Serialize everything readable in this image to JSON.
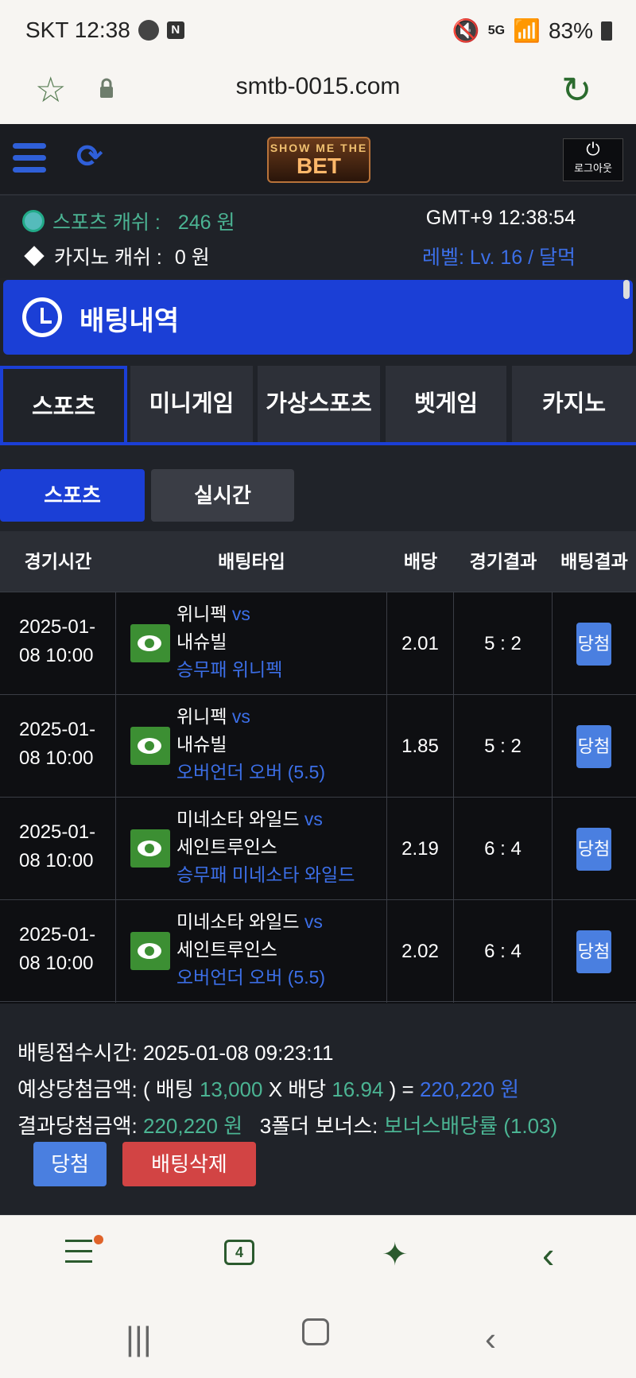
{
  "status_bar": {
    "carrier_time": "SKT 12:38",
    "battery": "83%",
    "network": "5G"
  },
  "browser": {
    "url": "smtb-0015.com"
  },
  "header": {
    "logo_top": "SHOW ME THE",
    "logo_main": "BET",
    "logout_label": "로그아웃"
  },
  "account": {
    "sports_cash_label": "스포츠 캐쉬 :",
    "sports_cash_value": "246 원",
    "casino_cash_label": "카지노 캐쉬 :",
    "casino_cash_value": "0 원",
    "clock": "GMT+9 12:38:54",
    "level": "레벨: Lv. 16 / 달먹"
  },
  "page_title": "배팅내역",
  "tabs": [
    "스포츠",
    "미니게임",
    "가상스포츠",
    "벳게임",
    "카지노"
  ],
  "subtabs": [
    "스포츠",
    "실시간"
  ],
  "table": {
    "headers": [
      "경기시간",
      "배팅타입",
      "배당",
      "경기결과",
      "배팅결과"
    ],
    "rows": [
      {
        "time1": "2025-01-",
        "time2": "08 10:00",
        "team1": "위니펙",
        "vs": "vs",
        "team2": "내슈빌",
        "pick": "승무패 위니펙",
        "odds": "2.01",
        "score": "5 : 2",
        "result": "당첨"
      },
      {
        "time1": "2025-01-",
        "time2": "08 10:00",
        "team1": "위니펙",
        "vs": "vs",
        "team2": "내슈빌",
        "pick": "오버언더 오버 (5.5)",
        "odds": "1.85",
        "score": "5 : 2",
        "result": "당첨"
      },
      {
        "time1": "2025-01-",
        "time2": "08 10:00",
        "team1": "미네소타 와일드",
        "vs": "vs",
        "team2": "세인트루인스",
        "pick": "승무패 미네소타 와일드",
        "odds": "2.19",
        "score": "6 : 4",
        "result": "당첨"
      },
      {
        "time1": "2025-01-",
        "time2": "08 10:00",
        "team1": "미네소타 와일드",
        "vs": "vs",
        "team2": "세인트루인스",
        "pick": "오버언더 오버 (5.5)",
        "odds": "2.02",
        "score": "6 : 4",
        "result": "당첨"
      }
    ]
  },
  "summary": {
    "bet_time": "배팅접수시간: 2025-01-08 09:23:11",
    "expected_label": "예상당첨금액: ( 배팅",
    "bet_amount": "13,000",
    "x_label": "X 배당",
    "total_odds": "16.94",
    "eq": ") =",
    "expected_win": "220,220 원",
    "result_label": "결과당첨금액:",
    "result_win": "220,220 원",
    "bonus_label": "3폴더 보너스:",
    "bonus_value": "보너스배당률 (1.03)",
    "win_button": "당첨",
    "delete_button": "배팅삭제"
  },
  "bottom_nav": {
    "tab_count": "4"
  },
  "colors": {
    "accent_blue": "#1b3fd6",
    "green": "#4bb493",
    "delete_red": "#d24444"
  }
}
